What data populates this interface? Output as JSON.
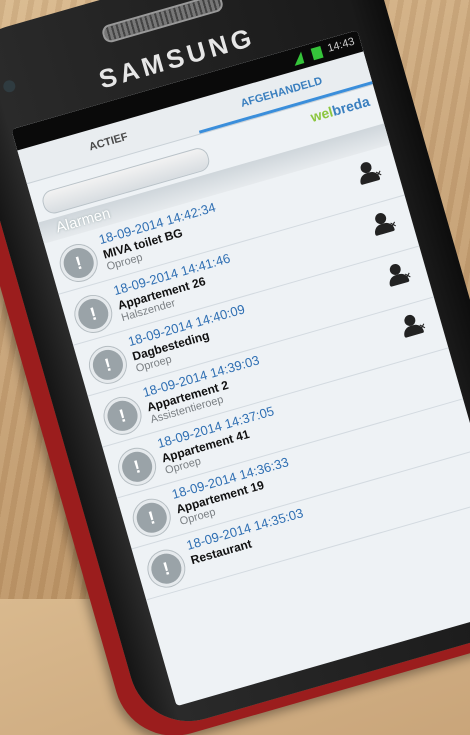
{
  "phone": {
    "brand": "SAMSUNG",
    "status_time": "14:43"
  },
  "tabs": [
    {
      "label": "ACTIEF",
      "active": false
    },
    {
      "label": "AFGEHANDELD",
      "active": true
    }
  ],
  "logo": {
    "part1": "wel",
    "part2": "breda"
  },
  "section_header": "Alarmen",
  "alarms": [
    {
      "timestamp": "18-09-2014 14:42:34",
      "title": "MIVA toilet BG",
      "subtitle": "Oproep"
    },
    {
      "timestamp": "18-09-2014 14:41:46",
      "title": "Appartement 26",
      "subtitle": "Halszender"
    },
    {
      "timestamp": "18-09-2014 14:40:09",
      "title": "Dagbesteding",
      "subtitle": "Oproep"
    },
    {
      "timestamp": "18-09-2014 14:39:03",
      "title": "Appartement 2",
      "subtitle": "Assistentieroep"
    },
    {
      "timestamp": "18-09-2014 14:37:05",
      "title": "Appartement 41",
      "subtitle": "Oproep"
    },
    {
      "timestamp": "18-09-2014 14:36:33",
      "title": "Appartement 19",
      "subtitle": "Oproep"
    },
    {
      "timestamp": "18-09-2014 14:35:03",
      "title": "Restaurant",
      "subtitle": ""
    }
  ],
  "icons": {
    "alert": "exclamation-icon",
    "user": "user-remove-icon"
  },
  "colors": {
    "accent": "#3a8edb",
    "timestamp": "#2f6fb3",
    "case_red": "#9b1d1d"
  }
}
